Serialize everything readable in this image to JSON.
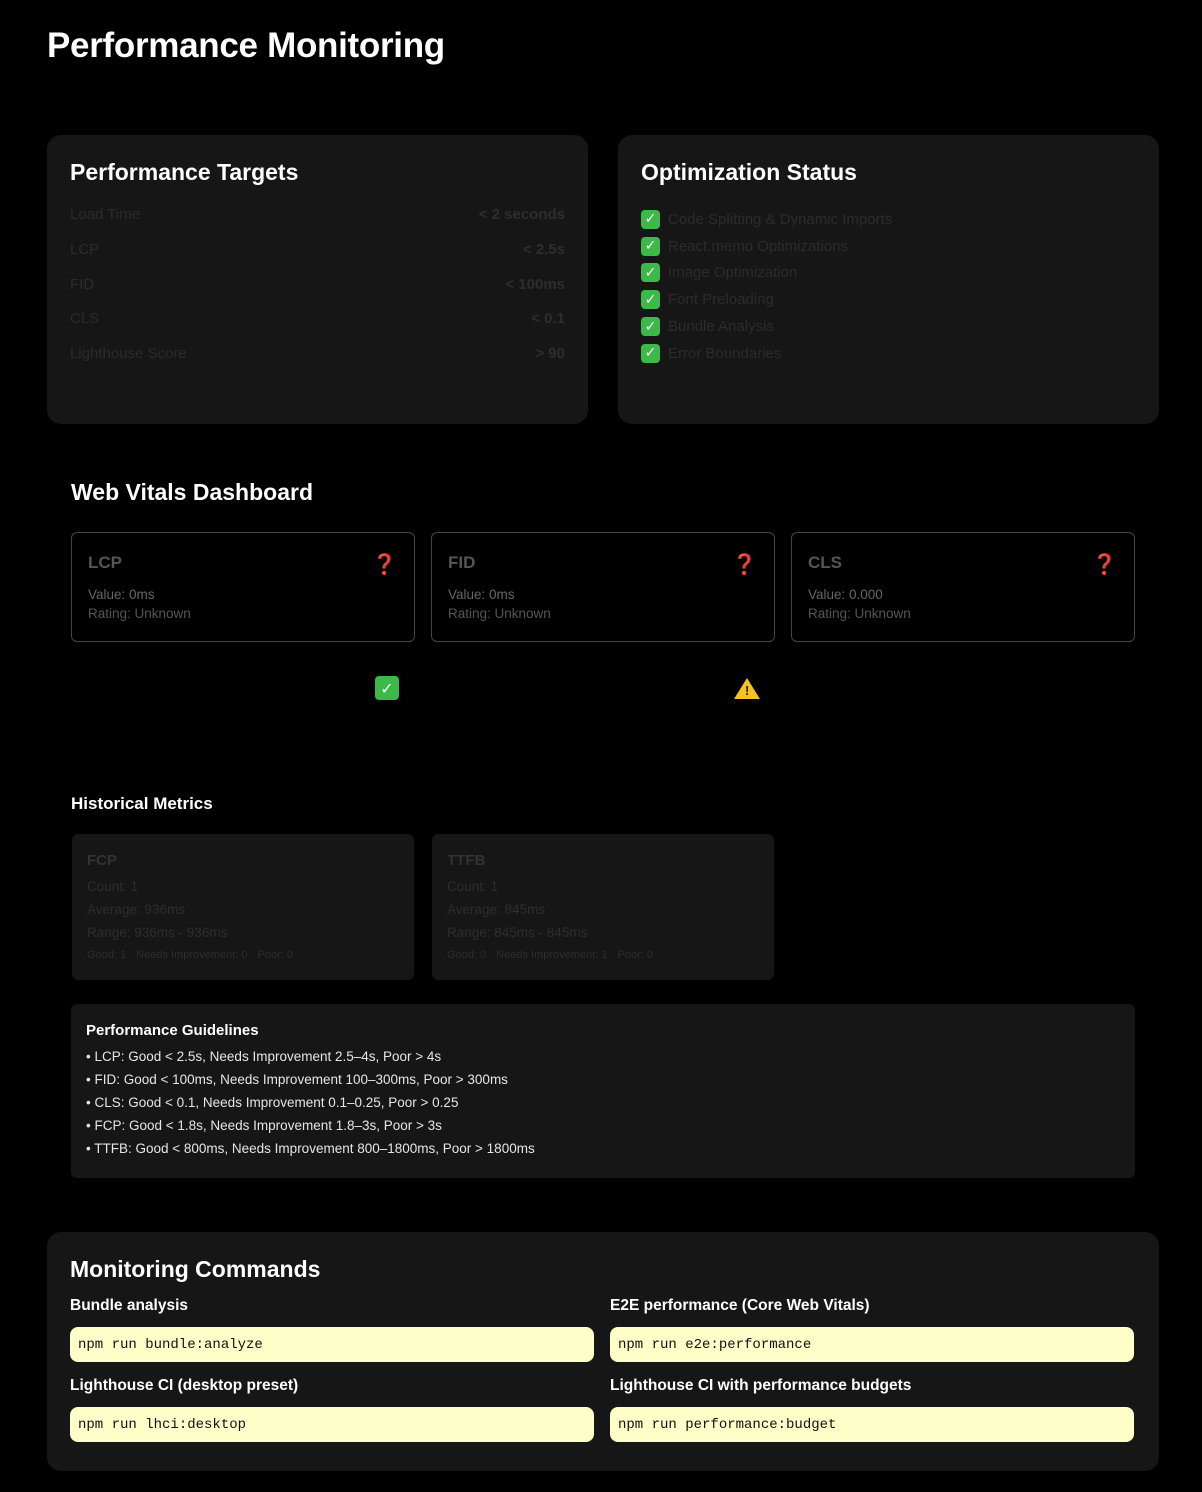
{
  "page_title": "Performance Monitoring",
  "targets": {
    "title": "Performance Targets",
    "rows": [
      {
        "label": "Load Time",
        "value": "< 2 seconds"
      },
      {
        "label": "LCP",
        "value": "< 2.5s"
      },
      {
        "label": "FID",
        "value": "< 100ms"
      },
      {
        "label": "CLS",
        "value": "< 0.1"
      },
      {
        "label": "Lighthouse Score",
        "value": "> 90"
      }
    ]
  },
  "optimization": {
    "title": "Optimization Status",
    "items": [
      "Code Splitting & Dynamic Imports",
      "React.memo Optimizations",
      "Image Optimization",
      "Font Preloading",
      "Bundle Analysis",
      "Error Boundaries"
    ],
    "check_glyph": "✓"
  },
  "web_vitals": {
    "title": "Web Vitals Dashboard",
    "cards": [
      {
        "name": "LCP",
        "value": "Value: 0ms",
        "rating": "Rating: Unknown",
        "icon": "❓"
      },
      {
        "name": "FID",
        "value": "Value: 0ms",
        "rating": "Rating: Unknown",
        "icon": "❓"
      },
      {
        "name": "CLS",
        "value": "Value: 0.000",
        "rating": "Rating: Unknown",
        "icon": "❓"
      }
    ],
    "status_check": "✓",
    "status_warn": "!"
  },
  "historical": {
    "title": "Historical Metrics",
    "cards": [
      {
        "name": "FCP",
        "count": "Count: 1",
        "average": "Average: 936ms",
        "range": "Range: 936ms - 936ms",
        "good": "Good: 1",
        "needs": "Needs Improvement: 0",
        "poor": "Poor: 0"
      },
      {
        "name": "TTFB",
        "count": "Count: 1",
        "average": "Average: 845ms",
        "range": "Range: 845ms - 845ms",
        "good": "Good: 0",
        "needs": "Needs Improvement: 1",
        "poor": "Poor: 0"
      }
    ]
  },
  "guidelines": {
    "title": "Performance Guidelines",
    "items": [
      "• LCP: Good < 2.5s, Needs Improvement 2.5–4s, Poor > 4s",
      "• FID: Good < 100ms, Needs Improvement 100–300ms, Poor > 300ms",
      "• CLS: Good < 0.1, Needs Improvement 0.1–0.25, Poor > 0.25",
      "• FCP: Good < 1.8s, Needs Improvement 1.8–3s, Poor > 3s",
      "• TTFB: Good < 800ms, Needs Improvement 800–1800ms, Poor > 1800ms"
    ]
  },
  "commands": {
    "title": "Monitoring Commands",
    "items": [
      {
        "label": "Bundle analysis",
        "code": "npm run bundle:analyze"
      },
      {
        "label": "E2E performance (Core Web Vitals)",
        "code": "npm run e2e:performance"
      },
      {
        "label": "Lighthouse CI (desktop preset)",
        "code": "npm run lhci:desktop"
      },
      {
        "label": "Lighthouse CI with performance budgets",
        "code": "npm run performance:budget"
      }
    ]
  },
  "colors": {
    "background": "#000000",
    "card": "#161616",
    "code_bg": "#fefec8",
    "check_green": "#3db94a",
    "question_red": "#d62828",
    "warn_yellow": "#f5c31d"
  }
}
